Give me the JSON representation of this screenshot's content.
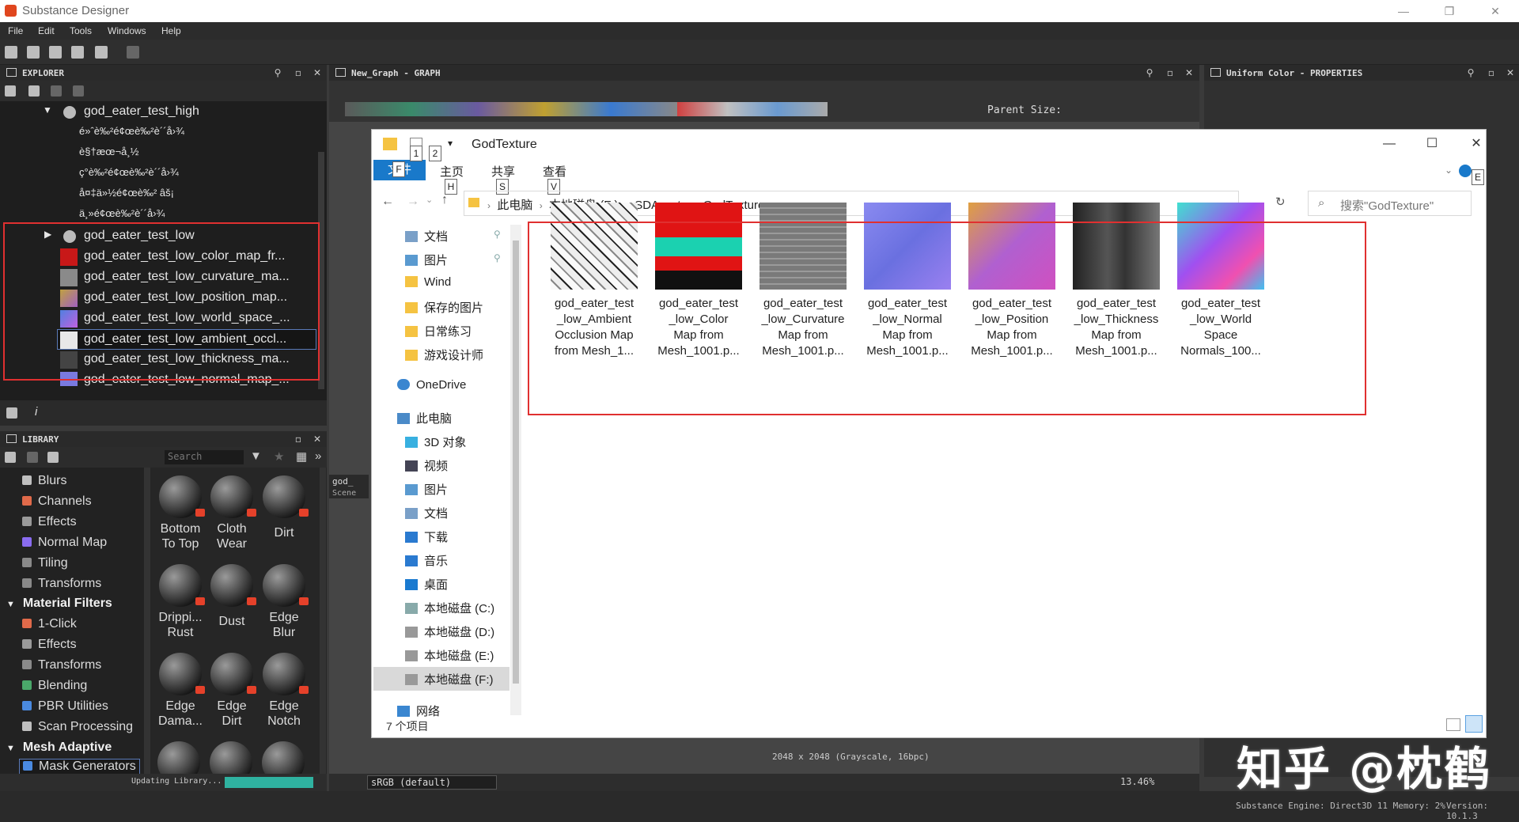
{
  "app": {
    "title": "Substance Designer",
    "menu": [
      "File",
      "Edit",
      "Tools",
      "Windows",
      "Help"
    ]
  },
  "explorer": {
    "panel_title": "EXPLORER",
    "rows": [
      {
        "label": "god_eater_test_high",
        "indent": 1
      },
      {
        "label": "é»ˆè‰²é¢œè‰²è´´å›¾",
        "indent": 2
      },
      {
        "label": "è§†æœ¬å¸½",
        "indent": 2
      },
      {
        "label": "ç°è‰²é¢œè‰²è´´å›¾",
        "indent": 2
      },
      {
        "label": "å¤‡ä»½é¢œè‰²  âš¡",
        "indent": 2
      },
      {
        "label": "ä¸»é¢œè‰²è´´å›¾",
        "indent": 2
      },
      {
        "label": "god_eater_test_low",
        "indent": 1
      },
      {
        "label": "god_eater_test_low_color_map_fr...",
        "indent": 1
      },
      {
        "label": "god_eater_test_low_curvature_ma...",
        "indent": 1
      },
      {
        "label": "god_eater_test_low_position_map...",
        "indent": 1
      },
      {
        "label": "god_eater_test_low_world_space_...",
        "indent": 1
      },
      {
        "label": "god_eater_test_low_ambient_occl...",
        "indent": 1
      },
      {
        "label": "god_eater_test_low_thickness_ma...",
        "indent": 1
      },
      {
        "label": "god_eater_test_low_normal_map_...",
        "indent": 1
      }
    ]
  },
  "library": {
    "panel_title": "LIBRARY",
    "search_placeholder": "Search",
    "categories": [
      {
        "label": "Blurs",
        "head": false,
        "color": "#bfbfbf"
      },
      {
        "label": "Channels",
        "head": false,
        "color": "#e06a4a"
      },
      {
        "label": "Effects",
        "head": false,
        "color": "#9a9a9a"
      },
      {
        "label": "Normal Map",
        "head": false,
        "color": "#8a6cf0"
      },
      {
        "label": "Tiling",
        "head": false,
        "color": "#8a8a8a"
      },
      {
        "label": "Transforms",
        "head": false,
        "color": "#8a8a8a"
      },
      {
        "label": "Material Filters",
        "head": true,
        "color": ""
      },
      {
        "label": "1-Click",
        "head": false,
        "color": "#e06a4a"
      },
      {
        "label": "Effects",
        "head": false,
        "color": "#9a9a9a"
      },
      {
        "label": "Transforms",
        "head": false,
        "color": "#8a8a8a"
      },
      {
        "label": "Blending",
        "head": false,
        "color": "#4aa86a"
      },
      {
        "label": "PBR Utilities",
        "head": false,
        "color": "#4a8ae0"
      },
      {
        "label": "Scan Processing",
        "head": false,
        "color": "#bfbfbf"
      },
      {
        "label": "Mesh Adaptive",
        "head": true,
        "color": ""
      },
      {
        "label": "Mask Generators",
        "head": false,
        "color": "#4a8ae0"
      }
    ],
    "materials": [
      [
        "Bottom",
        "To Top"
      ],
      [
        "Cloth",
        "Wear"
      ],
      [
        "Dirt",
        ""
      ],
      [
        "Drippi...",
        "Rust"
      ],
      [
        "Dust",
        ""
      ],
      [
        "Edge",
        "Blur"
      ],
      [
        "Edge",
        "Dama..."
      ],
      [
        "Edge",
        "Dirt"
      ],
      [
        "Edge",
        "Notch"
      ]
    ],
    "status": "Updating Library..."
  },
  "graph": {
    "panel_title": "New_Graph - GRAPH",
    "parent_size_label": "Parent Size:",
    "side_tab": "god_",
    "side_tab2": "Scene",
    "resolution_info": "2048 x 2048 (Grayscale, 16bpc)",
    "color_space": "sRGB (default)",
    "zoom": "13.46%"
  },
  "properties": {
    "panel_title": "Uniform Color - PROPERTIES"
  },
  "statusbar": {
    "engine": "Substance Engine: Direct3D 11 Memory: 2%",
    "version": "Version: 10.1.3"
  },
  "file_explorer": {
    "title": "GodTexture",
    "file_tab": "文件",
    "ribbon_tabs": [
      "主页",
      "共享",
      "查看"
    ],
    "keytips": [
      "1",
      "2",
      "F",
      "H",
      "S",
      "V",
      "E"
    ],
    "breadcrumbs": [
      "此电脑",
      "本地磁盘 (F:)",
      "SDAssets",
      "GodTexture"
    ],
    "search_placeholder": "搜索\"GodTexture\"",
    "nav_quick": [
      {
        "label": "文档",
        "icon": "document-icon",
        "pinned": true
      },
      {
        "label": "图片",
        "icon": "picture-icon",
        "pinned": true
      },
      {
        "label": "Wind",
        "icon": "folder-icon",
        "pinned": false
      },
      {
        "label": "保存的图片",
        "icon": "folder-icon",
        "pinned": false
      },
      {
        "label": "日常练习",
        "icon": "folder-icon",
        "pinned": false
      },
      {
        "label": "游戏设计师",
        "icon": "folder-icon",
        "pinned": false
      }
    ],
    "nav_onedrive": "OneDrive",
    "nav_pc": "此电脑",
    "nav_pc_items": [
      {
        "label": "3D 对象",
        "icon": "cube-icon"
      },
      {
        "label": "视频",
        "icon": "video-icon"
      },
      {
        "label": "图片",
        "icon": "picture-icon"
      },
      {
        "label": "文档",
        "icon": "document-icon"
      },
      {
        "label": "下载",
        "icon": "download-icon"
      },
      {
        "label": "音乐",
        "icon": "music-icon"
      },
      {
        "label": "桌面",
        "icon": "desktop-icon"
      },
      {
        "label": "本地磁盘 (C:)",
        "icon": "drive-icon"
      },
      {
        "label": "本地磁盘 (D:)",
        "icon": "drive-icon"
      },
      {
        "label": "本地磁盘 (E:)",
        "icon": "drive-icon"
      },
      {
        "label": "本地磁盘 (F:)",
        "icon": "drive-icon"
      }
    ],
    "nav_network": "网络",
    "item_count": "7 个项目",
    "files": [
      {
        "lines": [
          "god_eater_test",
          "_low_Ambient",
          "Occlusion Map",
          "from Mesh_1..."
        ],
        "kind": "ao"
      },
      {
        "lines": [
          "god_eater_test",
          "_low_Color",
          "Map from",
          "Mesh_1001.p..."
        ],
        "kind": "color"
      },
      {
        "lines": [
          "god_eater_test",
          "_low_Curvature",
          "Map from",
          "Mesh_1001.p..."
        ],
        "kind": "curvature"
      },
      {
        "lines": [
          "god_eater_test",
          "_low_Normal",
          "Map from",
          "Mesh_1001.p..."
        ],
        "kind": "normal"
      },
      {
        "lines": [
          "god_eater_test",
          "_low_Position",
          "Map from",
          "Mesh_1001.p..."
        ],
        "kind": "position"
      },
      {
        "lines": [
          "god_eater_test",
          "_low_Thickness",
          "Map from",
          "Mesh_1001.p..."
        ],
        "kind": "thickness"
      },
      {
        "lines": [
          "god_eater_test",
          "_low_World",
          "Space",
          "Normals_100..."
        ],
        "kind": "world"
      }
    ]
  },
  "watermark": "知乎 @枕鹤"
}
